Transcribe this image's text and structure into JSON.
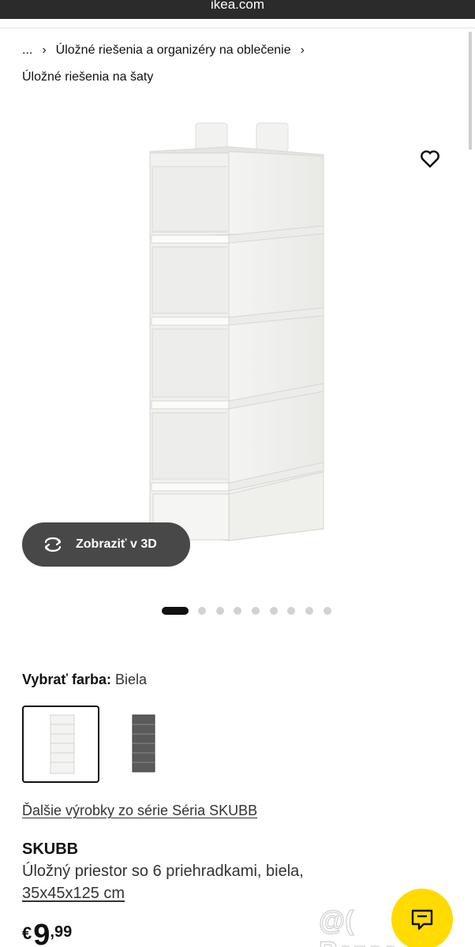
{
  "browser": {
    "url": "ikea.com"
  },
  "breadcrumb": {
    "ellipsis": "...",
    "separator": "›",
    "item1": "Úložné riešenia a organizéry na oblečenie",
    "item2": "Úložné riešenia na šaty"
  },
  "gallery": {
    "view3d_label": "Zobraziť v 3D",
    "image_count": 9,
    "active_index": 0
  },
  "color": {
    "label": "Vybrať farba:",
    "value": "Biela",
    "options": [
      "white-variant",
      "dark-grey-variant"
    ],
    "selected_index": 0
  },
  "series_link": "Ďalšie výrobky zo série Séria SKUBB",
  "product": {
    "name": "SKUBB",
    "description": "Úložný priestor so 6 priehradkami, biela,",
    "size": "35x45x125 cm"
  },
  "price": {
    "currency": "€",
    "integer": "9",
    "decimal": ",99"
  },
  "watermark": "@( Bazos.sk",
  "colors": {
    "accent": "#ffdb00",
    "dark": "#111111",
    "button": "#484848"
  },
  "icons": [
    "heart-icon",
    "rotate-3d-icon",
    "chat-icon"
  ]
}
